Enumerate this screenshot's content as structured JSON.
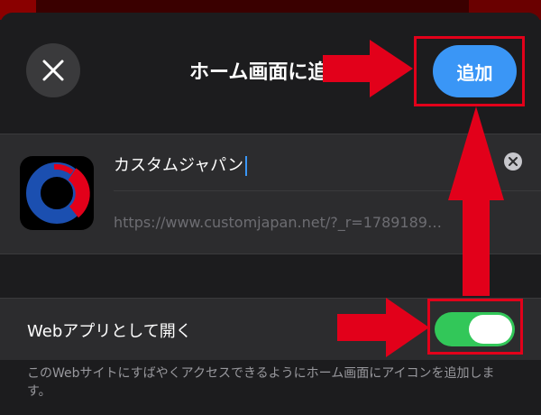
{
  "header": {
    "title": "ホーム画面に追加",
    "close_icon": "close-icon",
    "add_label": "追加"
  },
  "bookmark": {
    "name": "カスタムジャパン",
    "url": "https://www.customjapan.net/?_r=1789189…",
    "icon": "custom-japan-logo",
    "clear_icon": "clear-icon"
  },
  "web_app": {
    "label": "Webアプリとして開く",
    "enabled": true
  },
  "description": "このWebサイトにすばやくアクセスできるようにホーム画面にアイコンを追加します。",
  "colors": {
    "accent": "#3a96f6",
    "toggle_on": "#32c759",
    "annotation": "#e2001a",
    "background": "#1c1c1e"
  }
}
